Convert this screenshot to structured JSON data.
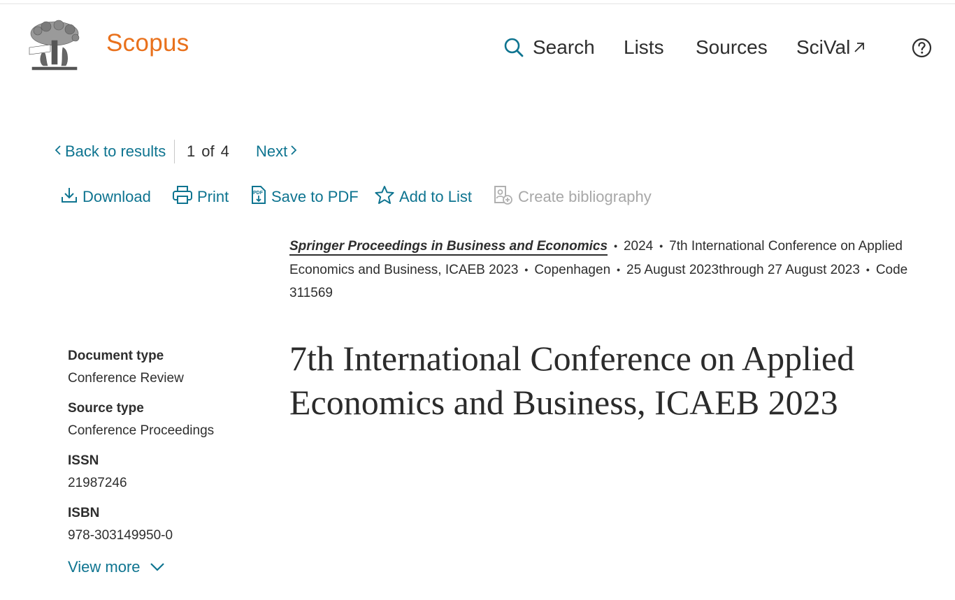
{
  "header": {
    "brand": "Scopus",
    "nav": {
      "search": "Search",
      "lists": "Lists",
      "sources": "Sources",
      "scival": "SciVal"
    },
    "colors": {
      "brand": "#e9711c",
      "link": "#0e7490",
      "text": "#2e2e2e"
    },
    "icons": [
      "elsevier-tree-logo",
      "search-icon",
      "external-link-icon",
      "help-icon"
    ]
  },
  "result_nav": {
    "back": "Back to results",
    "position": "1",
    "of": "of",
    "total": "4",
    "next": "Next"
  },
  "toolbar": {
    "download": "Download",
    "print": "Print",
    "save_pdf": "Save to PDF",
    "add_list": "Add to List",
    "create_bibliography": "Create bibliography"
  },
  "source": {
    "journal": "Springer Proceedings in Business and Economics",
    "year": "2024",
    "conference": "7th International Conference on Applied Economics and Business, ICAEB 2023",
    "location": "Copenhagen",
    "dates": "25 August 2023through 27 August 2023",
    "code": "Code 311569"
  },
  "document": {
    "title": "7th International Conference on Applied Economics and Business, ICAEB 2023"
  },
  "meta": {
    "document_type_label": "Document type",
    "document_type": "Conference Review",
    "source_type_label": "Source type",
    "source_type": "Conference Proceedings",
    "issn_label": "ISSN",
    "issn": "21987246",
    "isbn_label": "ISBN",
    "isbn": "978-303149950-0",
    "view_more": "View more"
  }
}
